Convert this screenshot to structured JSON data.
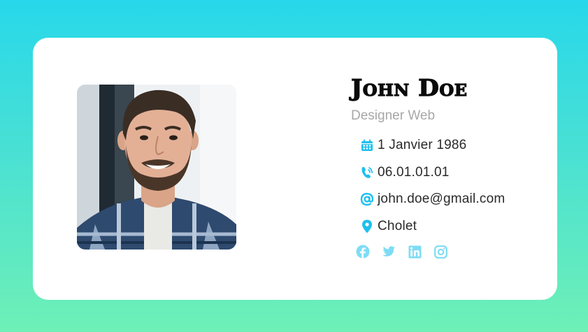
{
  "profile": {
    "name": "John Doe",
    "role": "Designer Web"
  },
  "details": {
    "birth_date": "1 Janvier 1986",
    "phone": "06.01.01.01",
    "email": "john.doe@gmail.com",
    "city": "Cholet"
  },
  "icons": {
    "calendar": "calendar-icon",
    "phone": "phone-icon",
    "email": "at-icon",
    "location": "map-pin-icon",
    "social": [
      "facebook-icon",
      "twitter-icon",
      "linkedin-icon",
      "instagram-icon"
    ]
  },
  "colors": {
    "accent": "#1ec0ee",
    "social": "#7fdcf5",
    "name": "#0b0b0b",
    "role": "#a7a7a7",
    "background_top": "#27d8ea",
    "background_bottom": "#6ef0b6"
  }
}
